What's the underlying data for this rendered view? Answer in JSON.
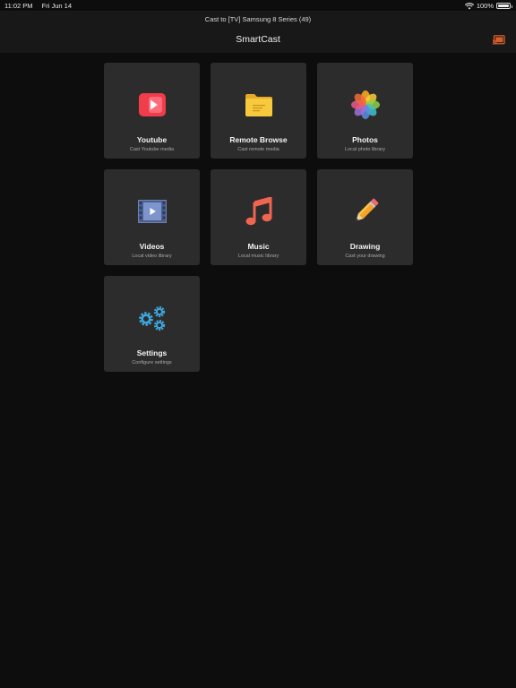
{
  "status_bar": {
    "time": "11:02 PM",
    "date": "Fri Jun 14",
    "battery": "100%",
    "battery_level": 1.0
  },
  "header": {
    "cast_status": "Cast to [TV] Samsung 8 Series (49)",
    "title": "SmartCast",
    "cast_icon": "cast-icon",
    "accent": "#e8662c"
  },
  "tiles": [
    {
      "title": "Youtube",
      "subtitle": "Cast Youtube media",
      "icon": "youtube-icon"
    },
    {
      "title": "Remote Browse",
      "subtitle": "Cast remote media",
      "icon": "folder-icon"
    },
    {
      "title": "Photos",
      "subtitle": "Local photo library",
      "icon": "photos-icon"
    },
    {
      "title": "Videos",
      "subtitle": "Local video library",
      "icon": "film-icon"
    },
    {
      "title": "Music",
      "subtitle": "Local music library",
      "icon": "music-note-icon"
    },
    {
      "title": "Drawing",
      "subtitle": "Cast your drawing",
      "icon": "pencil-icon"
    },
    {
      "title": "Settings",
      "subtitle": "Configure settings",
      "icon": "gears-icon"
    }
  ]
}
